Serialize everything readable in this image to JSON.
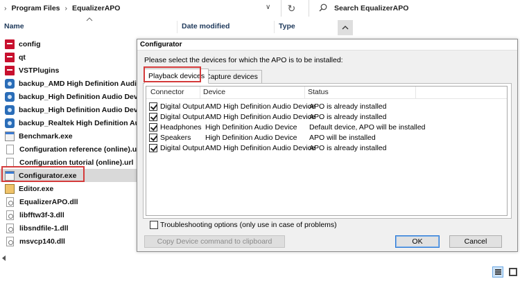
{
  "address": {
    "crumbs": [
      "Program Files",
      "EqualizerAPO"
    ],
    "search_placeholder": "Search EqualizerAPO"
  },
  "columns": {
    "name": "Name",
    "date_modified": "Date modified",
    "type": "Type"
  },
  "files": [
    {
      "name": "config",
      "icon": "red-folder-icon"
    },
    {
      "name": "qt",
      "icon": "red-folder-icon"
    },
    {
      "name": "VSTPlugins",
      "icon": "red-folder-icon"
    },
    {
      "name": "backup_AMD High Definition Audio De",
      "icon": "settings-file-icon"
    },
    {
      "name": "backup_High Definition Audio Device_H",
      "icon": "settings-file-icon"
    },
    {
      "name": "backup_High Definition Audio Device_S",
      "icon": "settings-file-icon"
    },
    {
      "name": "backup_Realtek High Definition Audio_S",
      "icon": "settings-file-icon"
    },
    {
      "name": "Benchmark.exe",
      "icon": "exe-icon"
    },
    {
      "name": "Configuration reference (online).url",
      "icon": "url-file-icon"
    },
    {
      "name": "Configuration tutorial (online).url",
      "icon": "url-file-icon"
    },
    {
      "name": "Configurator.exe",
      "icon": "exe-icon",
      "selected": true
    },
    {
      "name": "Editor.exe",
      "icon": "editor-exe-icon"
    },
    {
      "name": "EqualizerAPO.dll",
      "icon": "dll-icon"
    },
    {
      "name": "libfftw3f-3.dll",
      "icon": "dll-icon"
    },
    {
      "name": "libsndfile-1.dll",
      "icon": "dll-icon"
    },
    {
      "name": "msvcp140.dll",
      "icon": "dll-icon"
    }
  ],
  "dialog": {
    "title": "Configurator",
    "instruction": "Please select the devices for which the APO is to be installed:",
    "tabs": [
      "Playback devices",
      "Capture devices"
    ],
    "active_tab": "Playback devices",
    "headers": [
      "Connector",
      "Device",
      "Status"
    ],
    "devices": [
      {
        "checked": true,
        "connector": "Digital Output",
        "device": "AMD High Definition Audio Device",
        "status": "APO is already installed"
      },
      {
        "checked": true,
        "connector": "Digital Output",
        "device": "AMD High Definition Audio Device",
        "status": "APO is already installed"
      },
      {
        "checked": true,
        "connector": "Headphones",
        "device": "High Definition Audio Device",
        "status": "Default device, APO will be installed"
      },
      {
        "checked": true,
        "connector": "Speakers",
        "device": "High Definition Audio Device",
        "status": "APO will be installed"
      },
      {
        "checked": true,
        "connector": "Digital Output",
        "device": "AMD High Definition Audio Device",
        "status": "APO is already installed"
      }
    ],
    "troubleshooting_label": "Troubleshooting options (only use in case of problems)",
    "troubleshooting_checked": false,
    "copy_button": "Copy Device command to clipboard",
    "ok_button": "OK",
    "cancel_button": "Cancel"
  },
  "colors": {
    "highlight_box": "#d43a3a",
    "selected_row": "#d9d9d9",
    "dialog_bg": "#f0f0f0"
  }
}
